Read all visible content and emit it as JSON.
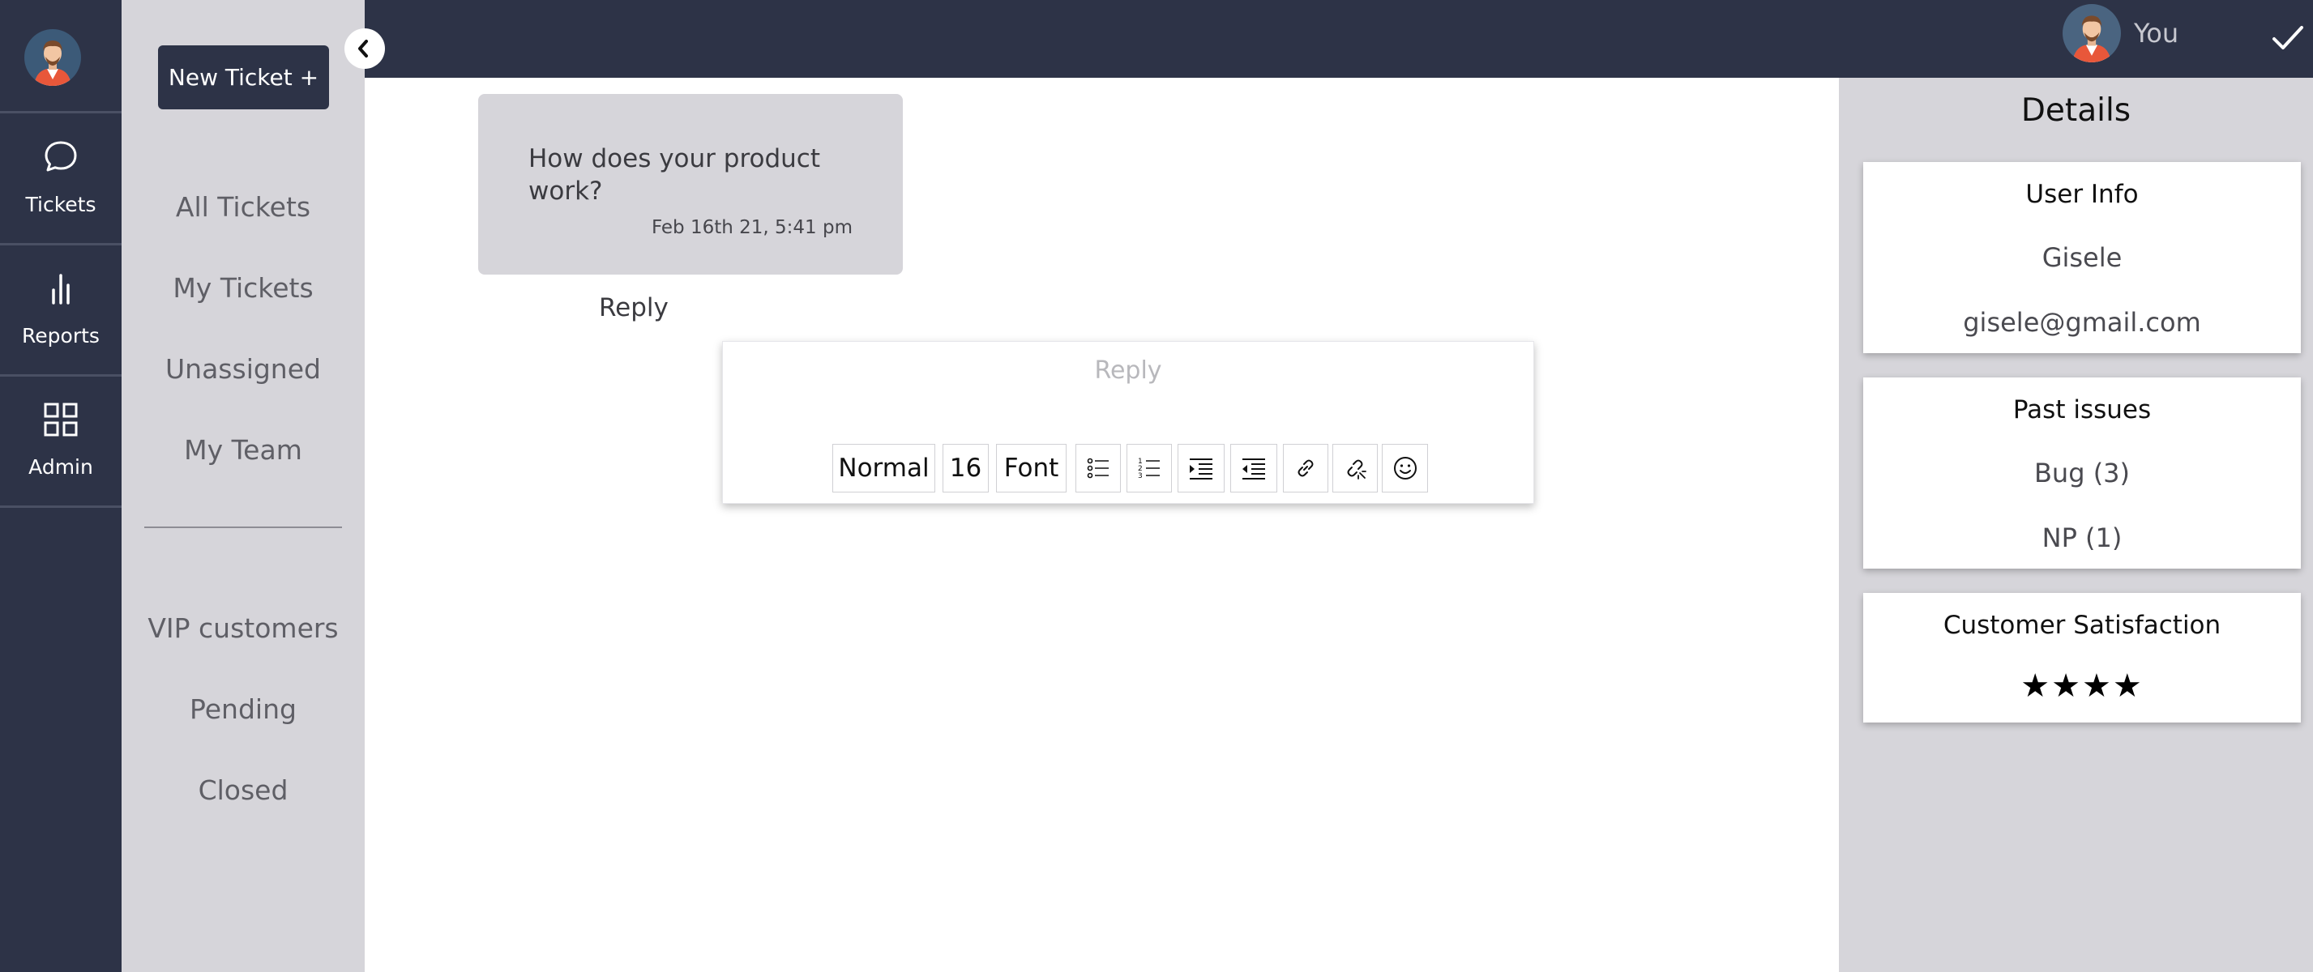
{
  "rail": {
    "items": [
      {
        "label": "Tickets",
        "icon": "chat-bubble-icon"
      },
      {
        "label": "Reports",
        "icon": "bar-chart-icon"
      },
      {
        "label": "Admin",
        "icon": "grid-icon"
      }
    ]
  },
  "nav": {
    "new_ticket_label": "New Ticket +",
    "links": [
      "All Tickets",
      "My Tickets",
      "Unassigned",
      "My Team"
    ],
    "views": [
      "VIP customers",
      "Pending",
      "Closed"
    ]
  },
  "header": {
    "user_label": "You"
  },
  "conversation": {
    "message_text": "How does your product work?",
    "message_time": "Feb 16th 21, 5:41 pm",
    "reply_link": "Reply",
    "editor_placeholder": "Reply",
    "toolbar": {
      "style_select": "Normal",
      "size_select": "16",
      "font_select": "Font"
    }
  },
  "details": {
    "title": "Details",
    "user_info": {
      "heading": "User Info",
      "name": "Gisele",
      "email": "gisele@gmail.com"
    },
    "past_issues": {
      "heading": "Past issues",
      "items": [
        "Bug (3)",
        "NP (1)"
      ]
    },
    "satisfaction": {
      "heading": "Customer Satisfaction",
      "stars_display": "★★★★",
      "rating": 4
    }
  },
  "colors": {
    "dark_navy": "#2d3347",
    "panel_gray": "#d6d5da"
  }
}
